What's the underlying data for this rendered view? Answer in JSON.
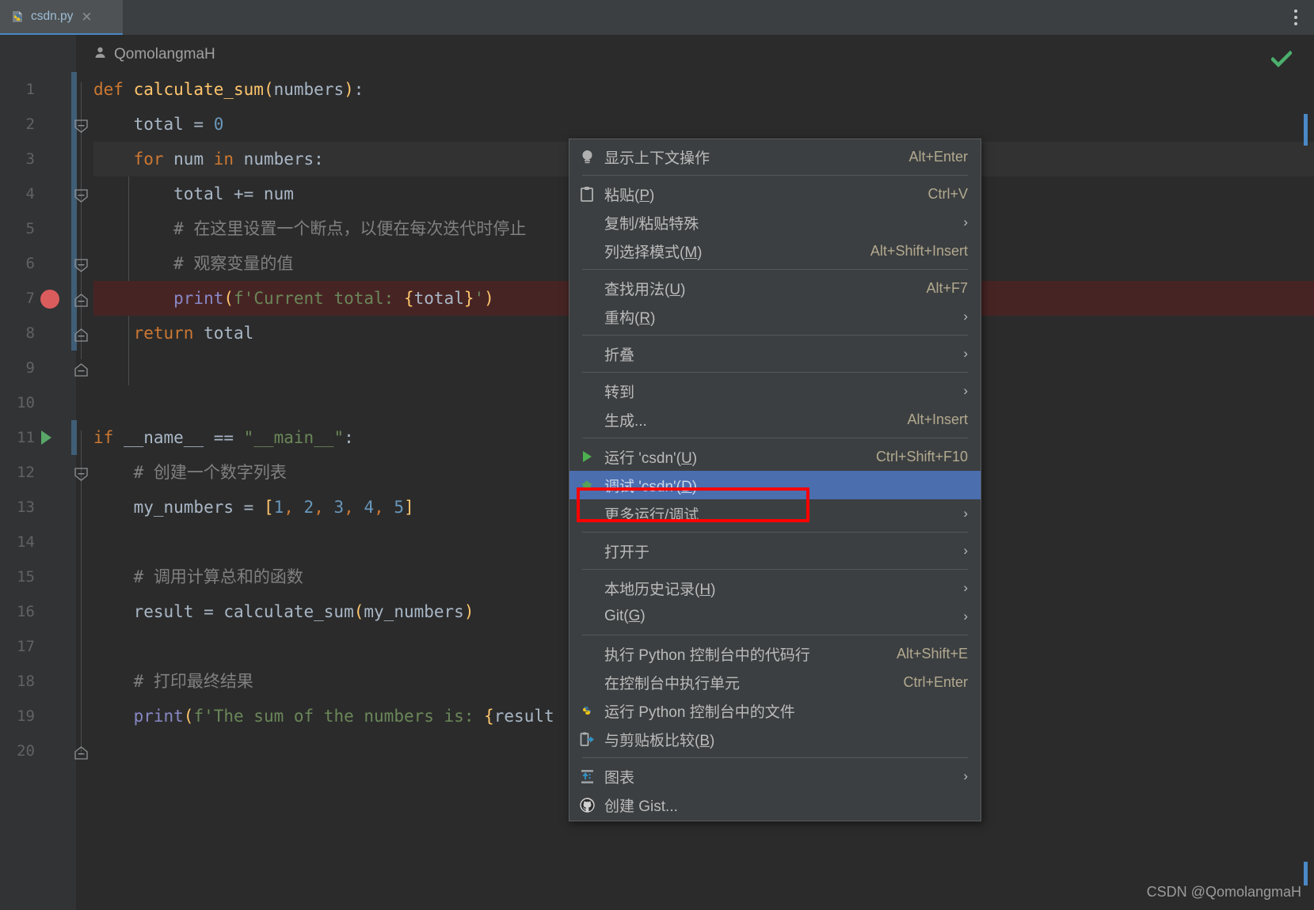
{
  "window": {
    "tab": {
      "label": "csdn.py",
      "icon": "python-file-icon",
      "close_icon": "close-icon"
    },
    "kebab_icon": "more-options-icon"
  },
  "editor": {
    "breadcrumb": {
      "label": "QomolangmaH",
      "icon": "user-icon"
    },
    "inspection_status_icon": "checkmark-icon",
    "line_numbers": [
      "1",
      "2",
      "3",
      "4",
      "5",
      "6",
      "7",
      "8",
      "9",
      "10",
      "11",
      "12",
      "13",
      "14",
      "15",
      "16",
      "17",
      "18",
      "19",
      "20"
    ],
    "breakpoint_line": "7",
    "run_marker_line": "11",
    "code": {
      "l1": "def calculate_sum(numbers):",
      "l2": "total = 0",
      "l3": "for num in numbers:",
      "l4": "total += num",
      "l5": "# 在这里设置一个断点，以便在每次迭代时停止",
      "l6": "# 观察变量的值",
      "l7": "print(f'Current total: {total}')",
      "l8": "return total",
      "l9": "",
      "l10": "",
      "l11": "if __name__ == \"__main__\":",
      "l12": "# 创建一个数字列表",
      "l13": "my_numbers = [1, 2, 3, 4, 5]",
      "l14": "",
      "l15": "# 调用计算总和的函数",
      "l16": "result = calculate_sum(my_numbers)",
      "l17": "",
      "l18": "# 打印最终结果",
      "l19": "print(f'The sum of the numbers is: {result",
      "l20": ""
    }
  },
  "context_menu": {
    "items": [
      {
        "label": "显示上下文操作",
        "shortcut": "Alt+Enter",
        "icon": "lightbulb-icon",
        "arrow": false,
        "selected": false
      },
      {
        "label": "粘贴(P)",
        "shortcut": "Ctrl+V",
        "icon": "clipboard-icon",
        "arrow": false,
        "selected": false
      },
      {
        "label": "复制/粘贴特殊",
        "shortcut": "",
        "icon": "",
        "arrow": true,
        "selected": false
      },
      {
        "label": "列选择模式(M)",
        "shortcut": "Alt+Shift+Insert",
        "icon": "",
        "arrow": false,
        "selected": false
      },
      {
        "label": "查找用法(U)",
        "shortcut": "Alt+F7",
        "icon": "",
        "arrow": false,
        "selected": false
      },
      {
        "label": "重构(R)",
        "shortcut": "",
        "icon": "",
        "arrow": true,
        "selected": false
      },
      {
        "label": "折叠",
        "shortcut": "",
        "icon": "",
        "arrow": true,
        "selected": false
      },
      {
        "label": "转到",
        "shortcut": "",
        "icon": "",
        "arrow": true,
        "selected": false
      },
      {
        "label": "生成...",
        "shortcut": "Alt+Insert",
        "icon": "",
        "arrow": false,
        "selected": false
      },
      {
        "label": "运行 'csdn'(U)",
        "shortcut": "Ctrl+Shift+F10",
        "icon": "run-icon",
        "arrow": false,
        "selected": false
      },
      {
        "label": "调试 'csdn'(D)",
        "shortcut": "",
        "icon": "debug-bug-icon",
        "arrow": false,
        "selected": true
      },
      {
        "label": "更多运行/调试",
        "shortcut": "",
        "icon": "",
        "arrow": true,
        "selected": false
      },
      {
        "label": "打开于",
        "shortcut": "",
        "icon": "",
        "arrow": true,
        "selected": false
      },
      {
        "label": "本地历史记录(H)",
        "shortcut": "",
        "icon": "",
        "arrow": true,
        "selected": false
      },
      {
        "label": "Git(G)",
        "shortcut": "",
        "icon": "",
        "arrow": true,
        "selected": false
      },
      {
        "label": "执行 Python 控制台中的代码行",
        "shortcut": "Alt+Shift+E",
        "icon": "",
        "arrow": false,
        "selected": false
      },
      {
        "label": "在控制台中执行单元",
        "shortcut": "Ctrl+Enter",
        "icon": "",
        "arrow": false,
        "selected": false
      },
      {
        "label": "运行 Python 控制台中的文件",
        "shortcut": "",
        "icon": "python-icon",
        "arrow": false,
        "selected": false
      },
      {
        "label": "与剪贴板比较(B)",
        "shortcut": "",
        "icon": "compare-clipboard-icon",
        "arrow": false,
        "selected": false
      },
      {
        "label": "图表",
        "shortcut": "",
        "icon": "diagram-icon",
        "arrow": true,
        "selected": false
      },
      {
        "label": "创建 Gist...",
        "shortcut": "",
        "icon": "github-icon",
        "arrow": false,
        "selected": false
      }
    ],
    "separators_after": [
      0,
      3,
      5,
      6,
      8,
      11,
      12,
      14,
      18
    ]
  },
  "annotation": {
    "color": "#ff0000",
    "target": "调试 'csdn'(D)"
  },
  "watermark": "CSDN @QomolangmaH",
  "colors": {
    "accent": "#4b6eaf",
    "breakpoint": "#db5c5c",
    "run_green": "#59a869",
    "editor_bg": "#2b2b2b",
    "menu_bg": "#3c3f41"
  }
}
